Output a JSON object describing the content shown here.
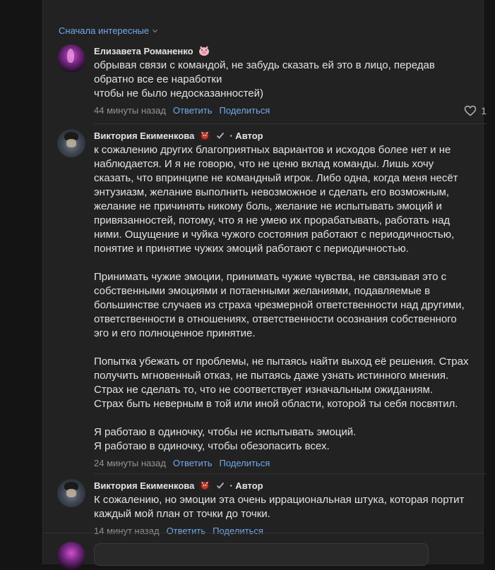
{
  "sort": {
    "label": "Сначала интересные"
  },
  "comments": [
    {
      "author": "Елизавета Романенко",
      "text": "обрывая связи с командой, не забудь сказать ей это в лицо, передав\nобратно все ее наработки\nчтобы не было недосказанностей)",
      "time": "44 минуты назад",
      "reply": "Ответить",
      "share": "Поделиться",
      "likes": "1"
    },
    {
      "author": "Виктория Екименкова",
      "author_tag": "· Автор",
      "text": "к сожалению других благоприятных вариантов и исходов более нет и не\nнаблюдается. И я не говорю, что не ценю вклад команды. Лишь хочу\nсказать, что впринципе не командный игрок. Либо одна, когда меня несёт\nэнтузиазм, желание выполнить невозможное и сделать его возможным,\nжелание не причинять никому боль, желание не испытывать эмоций и\nпривязанностей, потому, что я не умею их прорабатывать, работать над\nними. Ощущение и чуйка чужого состояния работают с периодичностью,\nпонятие и принятие чужих эмоций работают с периодичностью.\n\nПринимать чужие эмоции, принимать чужие чувства, не связывая это с\nсобственными эмоциями и потаенными желаниями, подавляемые в\nбольшинстве случаев из страха чрезмерной ответственности над другими,\nответственности в отношениях, ответственности осознания собственного\nэго и его полноценное принятие.\n\nПопытка убежать от проблемы, не пытаясь найти выход её решения. Страх\nполучить мгновенный отказ, не пытаясь даже узнать истинного мнения.\nСтрах не сделать то, что не соответствует изначальным ожиданиям.\nСтрах быть неверным в той или иной области, которой ты себя посвятил.\n\nЯ работаю в одиночку, чтобы не испытывать эмоций.\nЯ работаю в одиночку, чтобы обезопасить всех.",
      "time": "24 минуты назад",
      "reply": "Ответить",
      "share": "Поделиться"
    },
    {
      "author": "Виктория Екименкова",
      "author_tag": "· Автор",
      "text": "К сожалению, но эмоции эта очень иррациональная штука, которая портит\nкаждый мой план от точки до точки.",
      "time": "14 минут назад",
      "reply": "Ответить",
      "share": "Поделиться"
    }
  ],
  "colors": {
    "link": "#71aaeb",
    "background": "#141414",
    "card": "#222222",
    "text": "#e1e3e6",
    "muted": "#939393"
  },
  "icons": [
    "chevron-down-icon",
    "pig-emoji-icon",
    "heart-icon",
    "verified-check-icon",
    "devil-emoji-icon"
  ]
}
